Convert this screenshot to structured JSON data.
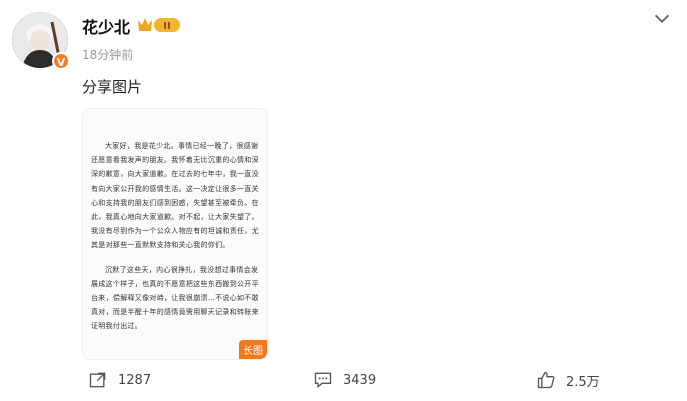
{
  "user": {
    "name": "花少北",
    "level_badge": "II",
    "verified_mark": "V",
    "timestamp": "18分钟前"
  },
  "post": {
    "text": "分享图片",
    "image": {
      "badge": "长图",
      "paragraphs": [
        "大家好，我是花少北。事情已经一晚了，很感谢还愿意看我发声的朋友。我怀着无比沉重的心情和深深的歉意，向大家道歉。在过去的七年中，我一直没有向大家公开我的感情生活。这一决定让很多一直关心和支持我的朋友们感到困惑，失望甚至被牵负。在此，我真心地向大家道歉。对不起，让大家失望了。我没有尽到作为一个公众人物应有的坦诚和责任，尤其是对那些一直默默支持和关心我的你们。",
        "沉默了这些天，内心很挣扎，我没想过事情会发展成这个样子，也真的不愿意把这些东西搬到公开平台来，偿解释又像对峙，让我很崩溃…不说心如不敢真对，而是半醒十年的感情竟需用聊天记录和转账来证明我付出过。"
      ]
    }
  },
  "actions": {
    "share_count": "1287",
    "comment_count": "3439",
    "like_count": "2.5万"
  },
  "icons": {
    "more": "chevron-down-icon",
    "share": "share-icon",
    "comment": "comment-icon",
    "like": "thumbs-up-icon",
    "level": "crown-icon"
  },
  "colors": {
    "accent": "#f07a1b",
    "muted": "#9a9a9a"
  }
}
